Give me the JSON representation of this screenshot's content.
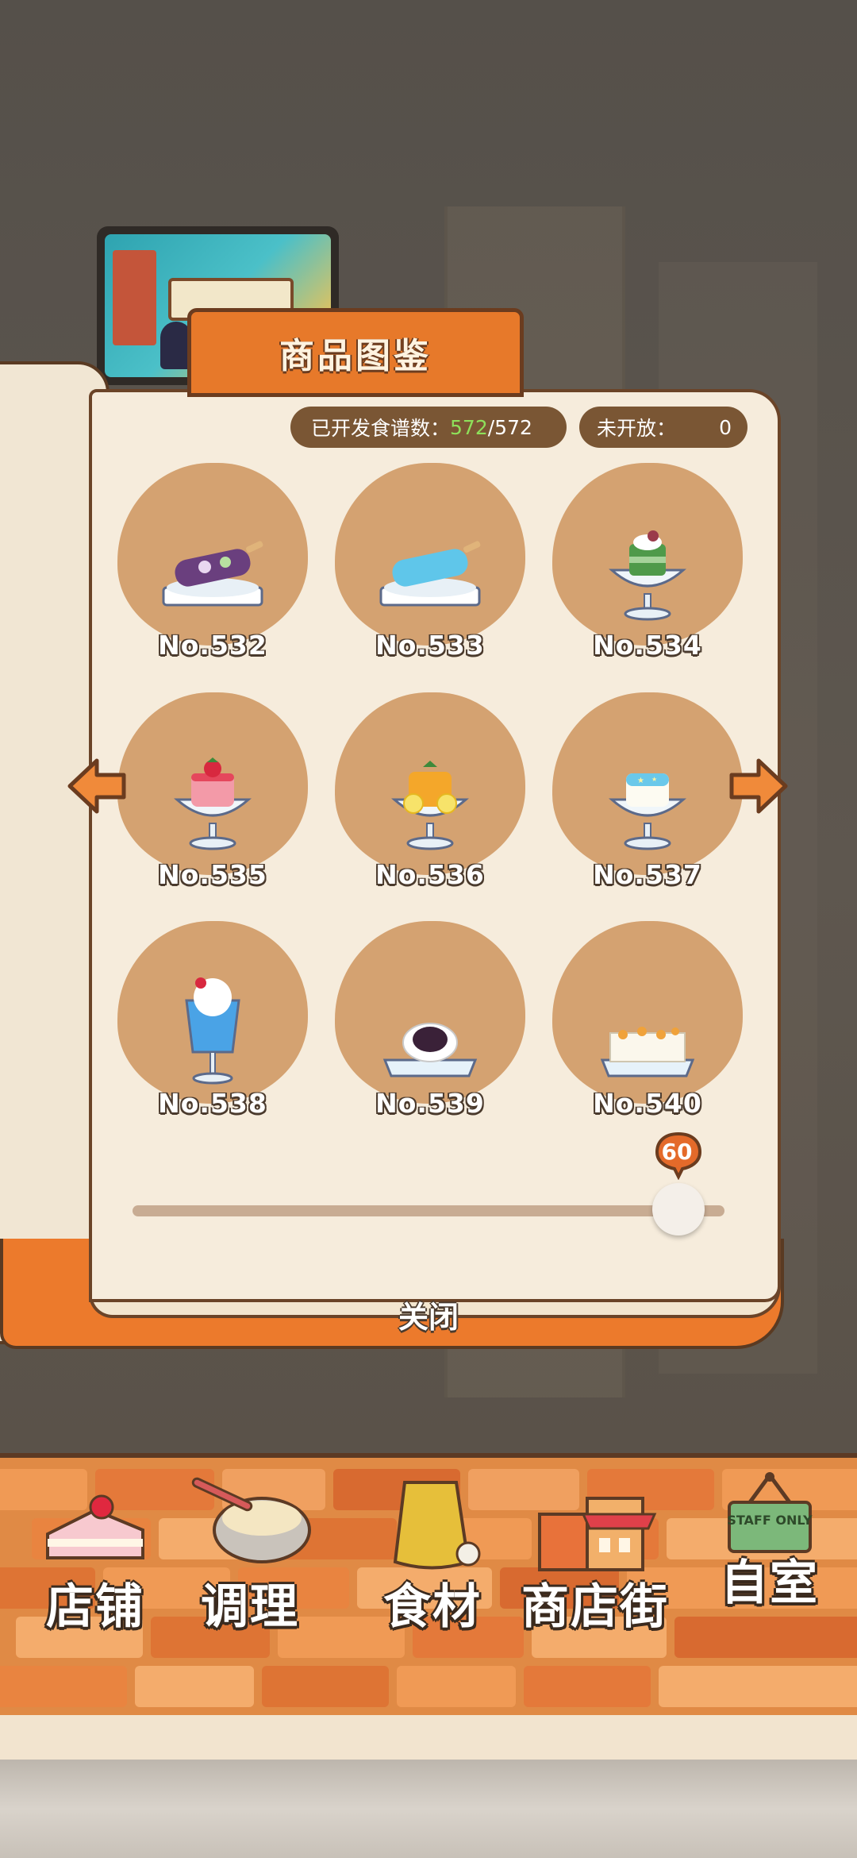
{
  "window": {
    "title": "商品图鉴"
  },
  "stats": {
    "developed_label": "已开发食谱数：",
    "developed_count": "572",
    "developed_total": "/572",
    "locked_label": "未开放：",
    "locked_count": "0"
  },
  "items": [
    {
      "label": "No.532",
      "icon": "purple-popsicle-on-ice"
    },
    {
      "label": "No.533",
      "icon": "blue-popsicle-on-ice"
    },
    {
      "label": "No.534",
      "icon": "green-tea-parfait-cup"
    },
    {
      "label": "No.535",
      "icon": "strawberry-mousse-cup"
    },
    {
      "label": "No.536",
      "icon": "orange-lemon-jelly-cup"
    },
    {
      "label": "No.537",
      "icon": "blue-star-panna-cotta-cup"
    },
    {
      "label": "No.538",
      "icon": "blue-soda-float-glass"
    },
    {
      "label": "No.539",
      "icon": "red-bean-mochi-plate"
    },
    {
      "label": "No.540",
      "icon": "almond-tofu-plate"
    }
  ],
  "slider": {
    "value": "60",
    "fraction": 0.94
  },
  "close_label": "关闭",
  "nav": [
    {
      "label": "店铺",
      "icon": "strawberry-cake-icon"
    },
    {
      "label": "调理",
      "icon": "mixing-bowl-icon"
    },
    {
      "label": "食材",
      "icon": "flour-sack-icon"
    },
    {
      "label": "商店街",
      "icon": "shop-building-icon"
    },
    {
      "label": "自室",
      "icon": "staff-only-sign-icon"
    }
  ],
  "staff_sign_text": "STAFF ONLY",
  "colors": {
    "accent": "#e7792a",
    "counter_bg": "#7a5634",
    "highlight_green": "#8ee05a",
    "plate_bg": "#d4a271"
  }
}
